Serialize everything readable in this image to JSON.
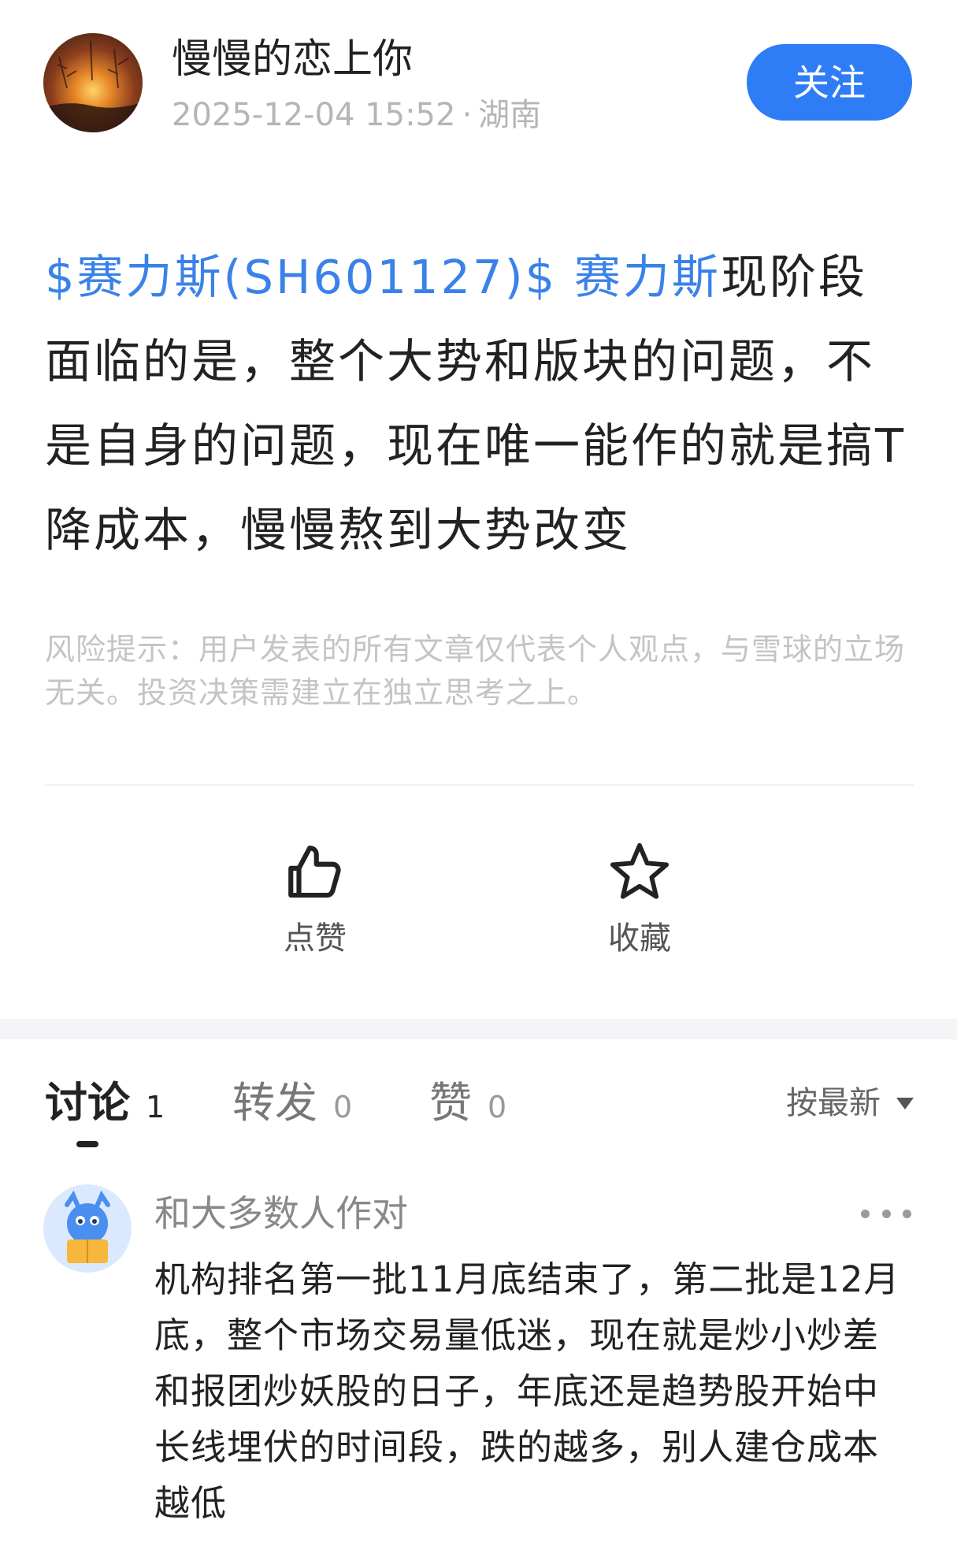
{
  "author": {
    "name": "慢慢的恋上你",
    "datetime": "2025-12-04 15:52",
    "separator": "·",
    "location": "湖南",
    "follow_label": "关注"
  },
  "post": {
    "stock_link": "$赛力斯(SH601127)$",
    "stock_name": "赛力斯",
    "text": "现阶段面临的是，整个大势和版块的问题，不是自身的问题，现在唯一能作的就是搞T降成本，慢慢熬到大势改变",
    "risk_notice": "风险提示：用户发表的所有文章仅代表个人观点，与雪球的立场无关。投资决策需建立在独立思考之上。"
  },
  "actions": {
    "like_label": "点赞",
    "like_icon": "thumbs-up-icon",
    "favorite_label": "收藏",
    "favorite_icon": "star-icon"
  },
  "tabs": [
    {
      "label": "讨论",
      "count": "1",
      "active": true
    },
    {
      "label": "转发",
      "count": "0",
      "active": false
    },
    {
      "label": "赞",
      "count": "0",
      "active": false
    }
  ],
  "sort": {
    "label": "按最新",
    "icon": "caret-down-icon"
  },
  "comment": {
    "author": "和大多数人作对",
    "more_icon": "more-dots-icon",
    "text": "机构排名第一批11月底结束了，第二批是12月底，整个市场交易量低迷，现在就是炒小炒差和报团炒妖股的日子，年底还是趋势股开始中长线埋伏的时间段，跌的越多，别人建仓成本越低"
  },
  "colors": {
    "accent": "#2f7df6",
    "link": "#3a82e8",
    "muted": "#b5b5b5"
  }
}
